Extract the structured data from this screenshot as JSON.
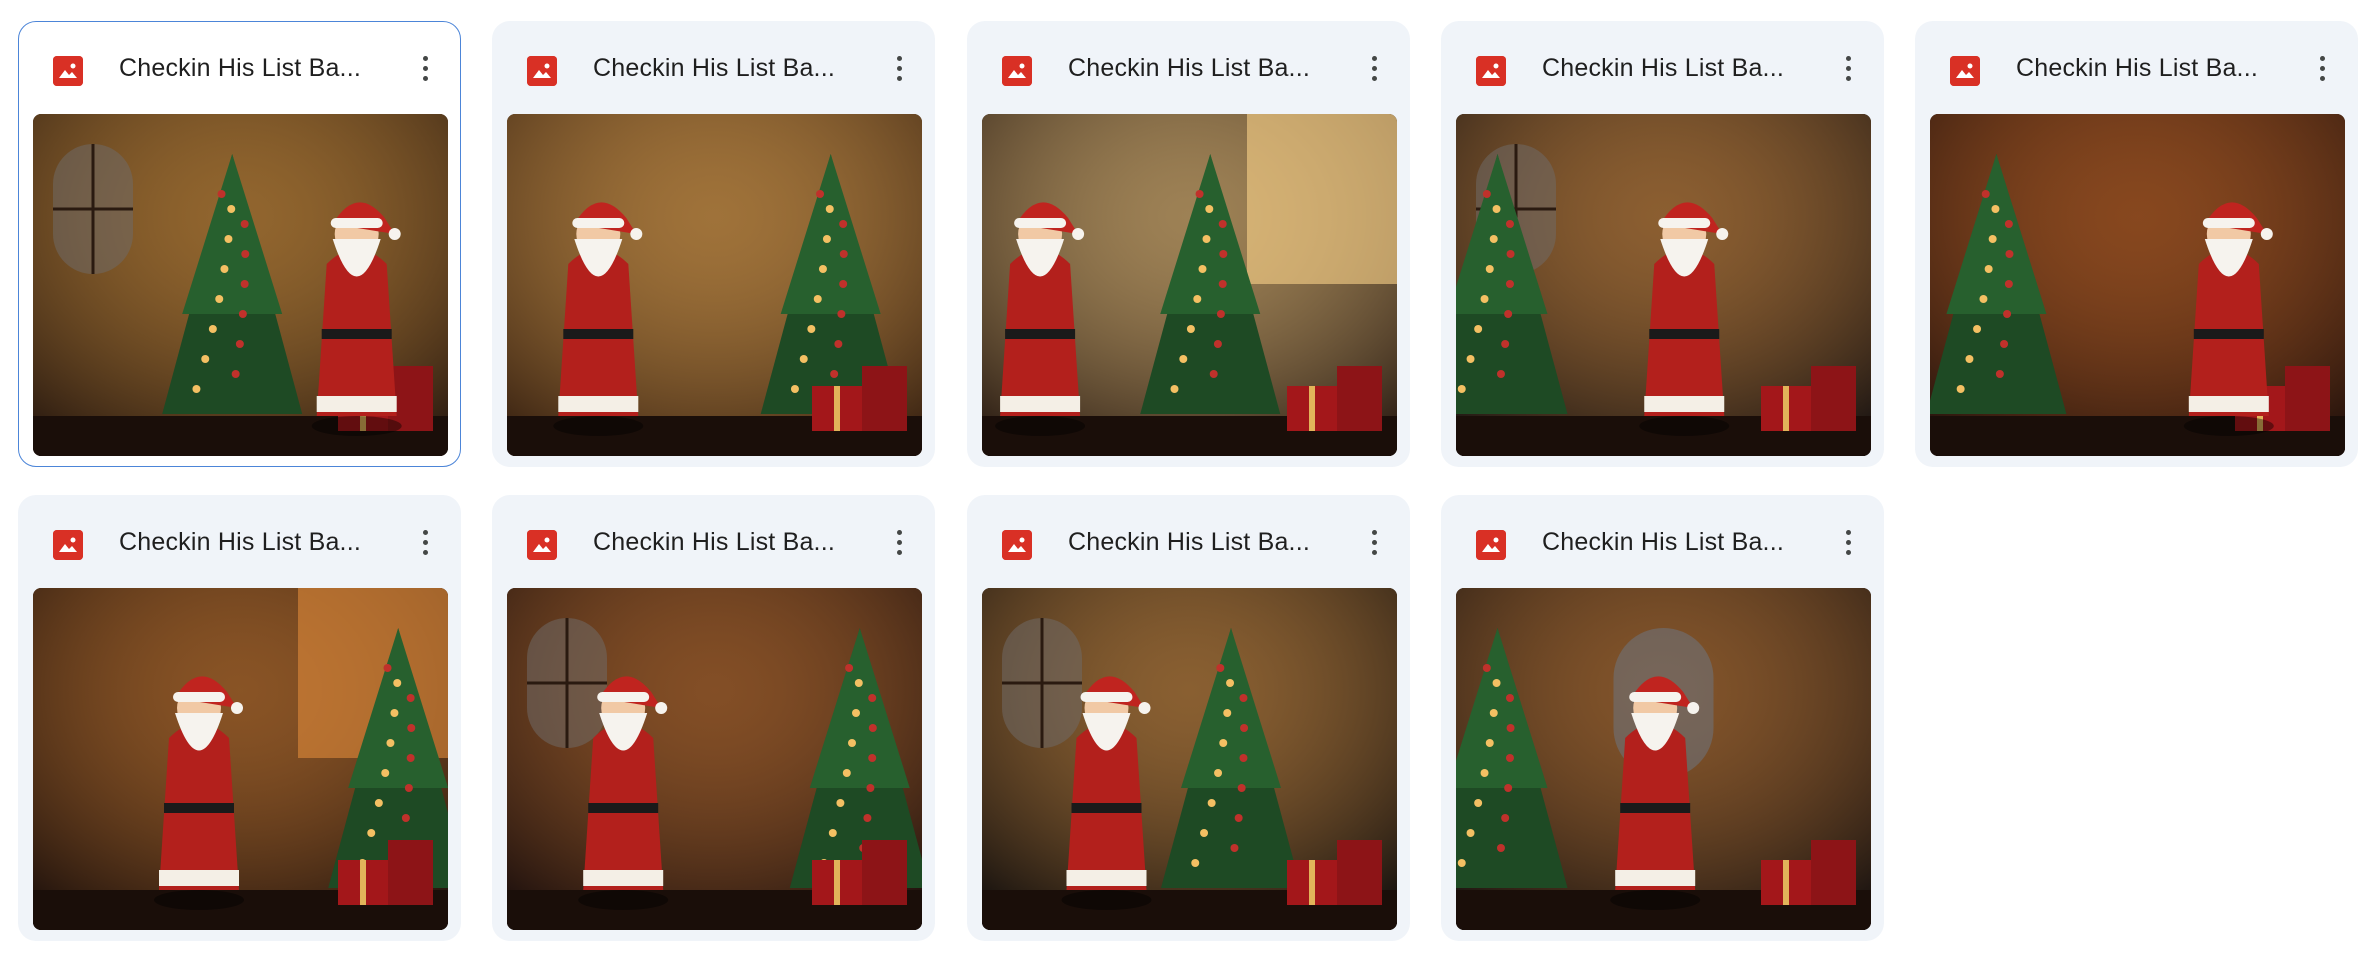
{
  "files": [
    {
      "name": "Checkin His List Ba...",
      "selected": true,
      "icon": "image-file-icon"
    },
    {
      "name": "Checkin His List Ba...",
      "selected": false,
      "icon": "image-file-icon"
    },
    {
      "name": "Checkin His List Ba...",
      "selected": false,
      "icon": "image-file-icon"
    },
    {
      "name": "Checkin His List Ba...",
      "selected": false,
      "icon": "image-file-icon"
    },
    {
      "name": "Checkin His List Ba...",
      "selected": false,
      "icon": "image-file-icon"
    },
    {
      "name": "Checkin His List Ba...",
      "selected": false,
      "icon": "image-file-icon"
    },
    {
      "name": "Checkin His List Ba...",
      "selected": false,
      "icon": "image-file-icon"
    },
    {
      "name": "Checkin His List Ba...",
      "selected": false,
      "icon": "image-file-icon"
    },
    {
      "name": "Checkin His List Ba...",
      "selected": false,
      "icon": "image-file-icon"
    }
  ],
  "colors": {
    "accent": "#4c85d8",
    "icon_red": "#d93025",
    "card_bg": "#f0f4f9"
  }
}
